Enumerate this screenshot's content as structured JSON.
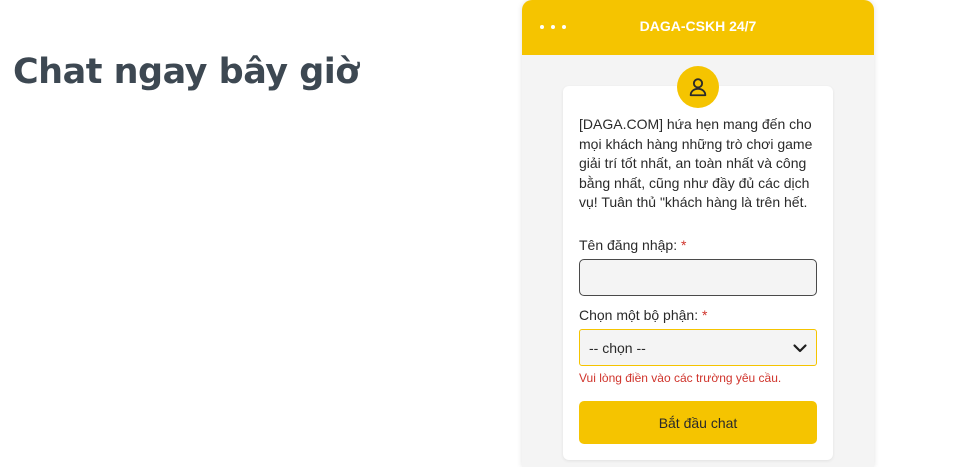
{
  "page": {
    "heading": "Chat ngay bây giờ"
  },
  "widget": {
    "title": "DAGA-CSKH 24/7",
    "menu_icon": "more-dots-icon",
    "avatar_icon": "user-icon",
    "intro_text": "[DAGA.COM] hứa hẹn mang đến cho mọi khách hàng những trò chơi game giải trí tốt nhất, an toàn nhất và công bằng nhất, cũng như đầy đủ các dịch vụ! Tuân thủ \"khách hàng là trên hết.",
    "form": {
      "username_label": "Tên đăng nhập:",
      "required_mark": "*",
      "username_value": "",
      "department_label": "Chọn một bộ phận:",
      "department_selected": "-- chọn --",
      "error_text": "Vui lòng điền vào các trường yêu cầu.",
      "start_button": "Bắt đầu chat"
    },
    "colors": {
      "accent": "#f5c400",
      "error": "#d0342c",
      "panel_bg": "#f4f4f4"
    }
  }
}
